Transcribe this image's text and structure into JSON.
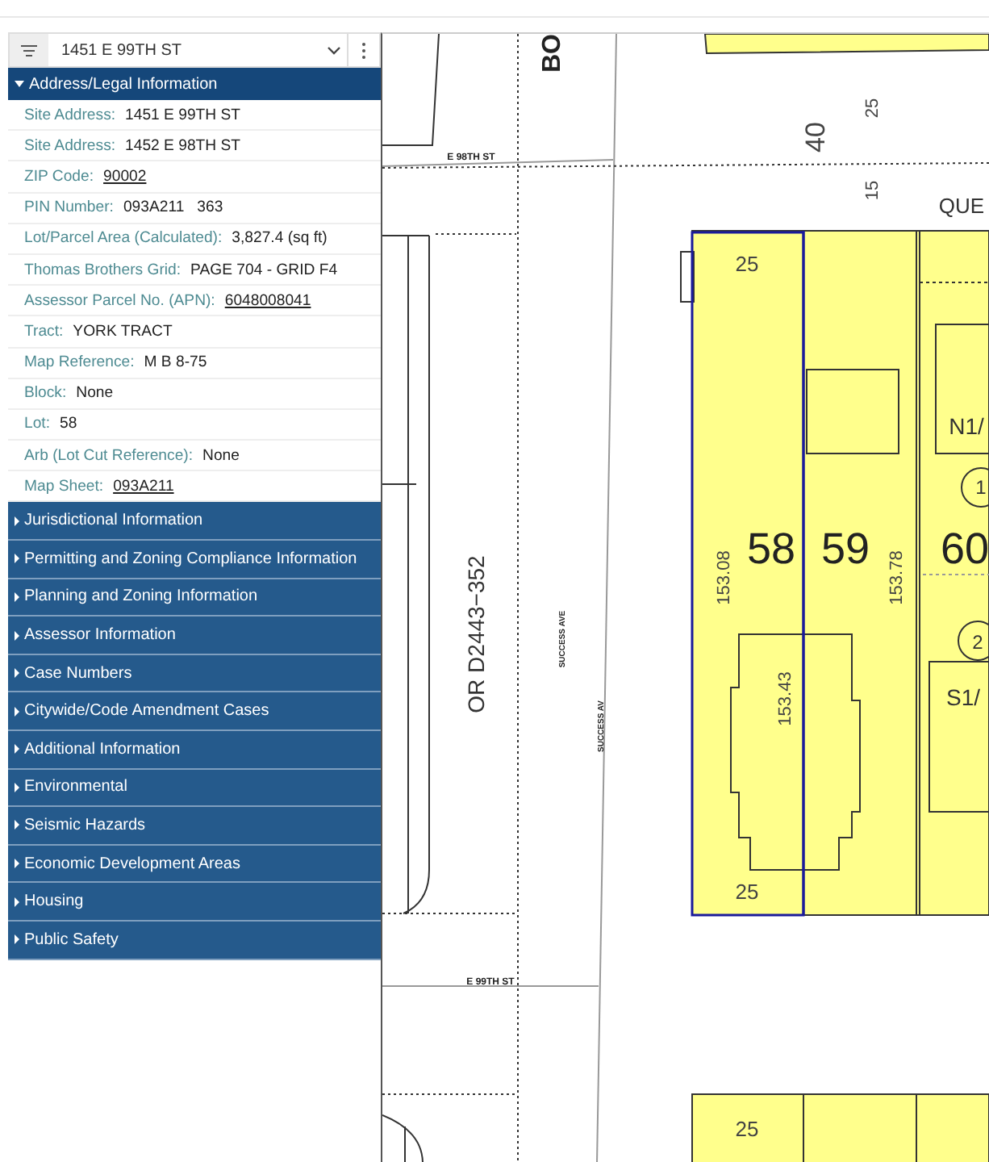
{
  "search": {
    "value": "1451 E 99TH ST"
  },
  "sections": [
    {
      "title": "Address/Legal Information",
      "expanded": true,
      "fields": [
        {
          "label": "Site Address:",
          "value": "1451 E 99TH ST",
          "link": false
        },
        {
          "label": "Site Address:",
          "value": "1452 E 98TH ST",
          "link": false
        },
        {
          "label": "ZIP Code:",
          "value": "90002",
          "link": true
        },
        {
          "label": "PIN Number:",
          "value": "093A211   363",
          "link": false
        },
        {
          "label": "Lot/Parcel Area (Calculated):",
          "value": "3,827.4 (sq ft)",
          "link": false
        },
        {
          "label": "Thomas Brothers Grid:",
          "value": "PAGE 704 - GRID F4",
          "link": false
        },
        {
          "label": "Assessor Parcel No. (APN):",
          "value": "6048008041",
          "link": true
        },
        {
          "label": "Tract:",
          "value": "YORK TRACT",
          "link": false
        },
        {
          "label": "Map Reference:",
          "value": "M B 8-75",
          "link": false
        },
        {
          "label": "Block:",
          "value": "None",
          "link": false
        },
        {
          "label": "Lot:",
          "value": "58",
          "link": false
        },
        {
          "label": "Arb (Lot Cut Reference):",
          "value": "None",
          "link": false
        },
        {
          "label": "Map Sheet:",
          "value": "093A211",
          "link": true
        }
      ]
    },
    {
      "title": "Jurisdictional Information",
      "expanded": false
    },
    {
      "title": "Permitting and Zoning Compliance Information",
      "expanded": false
    },
    {
      "title": "Planning and Zoning Information",
      "expanded": false
    },
    {
      "title": "Assessor Information",
      "expanded": false
    },
    {
      "title": "Case Numbers",
      "expanded": false
    },
    {
      "title": "Citywide/Code Amendment Cases",
      "expanded": false
    },
    {
      "title": "Additional Information",
      "expanded": false
    },
    {
      "title": "Environmental",
      "expanded": false
    },
    {
      "title": "Seismic Hazards",
      "expanded": false
    },
    {
      "title": "Economic Development Areas",
      "expanded": false
    },
    {
      "title": "Housing",
      "expanded": false
    },
    {
      "title": "Public Safety",
      "expanded": false
    }
  ],
  "map": {
    "labels": [
      {
        "text": "BO",
        "kind": "street"
      },
      {
        "text": "E 98TH ST",
        "kind": "street"
      },
      {
        "text": "40",
        "kind": "dimension"
      },
      {
        "text": "25",
        "kind": "dimension"
      },
      {
        "text": "15",
        "kind": "dimension"
      },
      {
        "text": "QUE",
        "kind": "note"
      },
      {
        "text": "25",
        "kind": "dimension"
      },
      {
        "text": "N1/",
        "kind": "note"
      },
      {
        "text": "1",
        "kind": "circled"
      },
      {
        "text": "58",
        "kind": "lot"
      },
      {
        "text": "59",
        "kind": "lot"
      },
      {
        "text": "60",
        "kind": "lot"
      },
      {
        "text": "153.08",
        "kind": "dimension"
      },
      {
        "text": "153.78",
        "kind": "dimension"
      },
      {
        "text": "OR D2443−352",
        "kind": "note"
      },
      {
        "text": "SUCCESS AVE",
        "kind": "street"
      },
      {
        "text": "2",
        "kind": "circled"
      },
      {
        "text": "S1/",
        "kind": "note"
      },
      {
        "text": "153.43",
        "kind": "dimension"
      },
      {
        "text": "SUCCESS AV",
        "kind": "street"
      },
      {
        "text": "25",
        "kind": "dimension"
      },
      {
        "text": "E 99TH ST",
        "kind": "street"
      },
      {
        "text": "25",
        "kind": "dimension"
      }
    ]
  }
}
